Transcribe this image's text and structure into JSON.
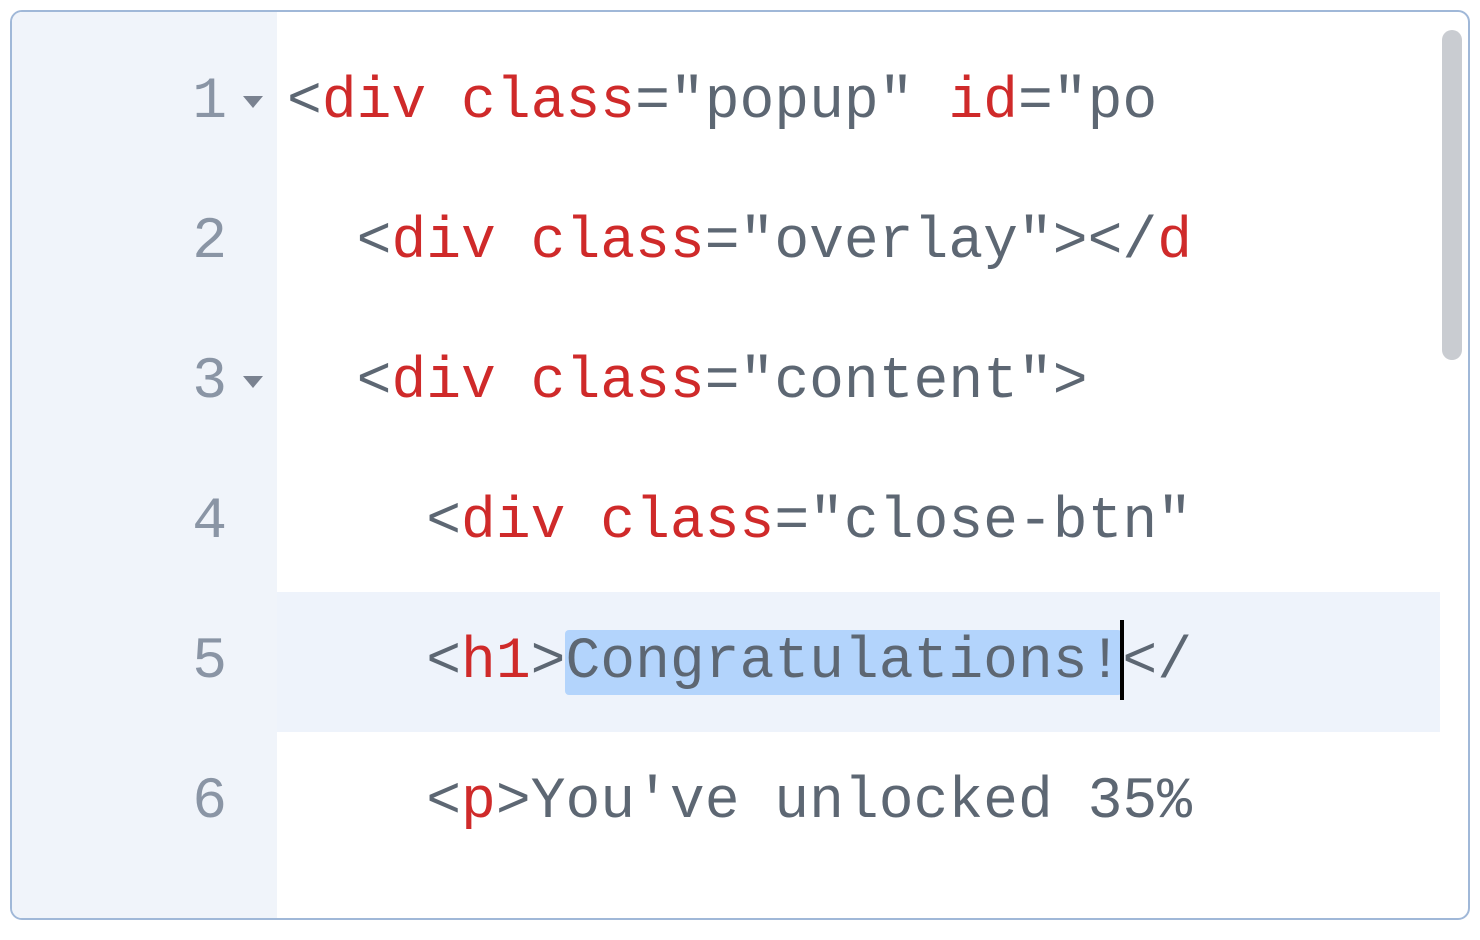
{
  "editor": {
    "lines": [
      {
        "number": "1",
        "foldable": true,
        "indent": "",
        "tokens": [
          {
            "t": "bracket",
            "v": "<"
          },
          {
            "t": "tag",
            "v": "div"
          },
          {
            "t": "text",
            "v": " "
          },
          {
            "t": "attr",
            "v": "class"
          },
          {
            "t": "punct",
            "v": "="
          },
          {
            "t": "string",
            "v": "\"popup\""
          },
          {
            "t": "text",
            "v": " "
          },
          {
            "t": "attr",
            "v": "id"
          },
          {
            "t": "punct",
            "v": "="
          },
          {
            "t": "string",
            "v": "\"po"
          }
        ]
      },
      {
        "number": "2",
        "foldable": false,
        "indent": "  ",
        "tokens": [
          {
            "t": "bracket",
            "v": "<"
          },
          {
            "t": "tag",
            "v": "div"
          },
          {
            "t": "text",
            "v": " "
          },
          {
            "t": "attr",
            "v": "class"
          },
          {
            "t": "punct",
            "v": "="
          },
          {
            "t": "string",
            "v": "\"overlay\""
          },
          {
            "t": "bracket",
            "v": ">"
          },
          {
            "t": "bracket",
            "v": "</"
          },
          {
            "t": "tag",
            "v": "d"
          }
        ]
      },
      {
        "number": "3",
        "foldable": true,
        "indent": "  ",
        "tokens": [
          {
            "t": "bracket",
            "v": "<"
          },
          {
            "t": "tag",
            "v": "div"
          },
          {
            "t": "text",
            "v": " "
          },
          {
            "t": "attr",
            "v": "class"
          },
          {
            "t": "punct",
            "v": "="
          },
          {
            "t": "string",
            "v": "\"content\""
          },
          {
            "t": "bracket",
            "v": ">"
          }
        ]
      },
      {
        "number": "4",
        "foldable": false,
        "indent": "    ",
        "tokens": [
          {
            "t": "bracket",
            "v": "<"
          },
          {
            "t": "tag",
            "v": "div"
          },
          {
            "t": "text",
            "v": " "
          },
          {
            "t": "attr",
            "v": "class"
          },
          {
            "t": "punct",
            "v": "="
          },
          {
            "t": "string",
            "v": "\"close-btn\""
          }
        ]
      },
      {
        "number": "5",
        "foldable": false,
        "active": true,
        "indent": "    ",
        "tokens": [
          {
            "t": "bracket",
            "v": "<"
          },
          {
            "t": "tag",
            "v": "h1"
          },
          {
            "t": "bracket",
            "v": ">"
          },
          {
            "t": "text",
            "v": "Congratulations!",
            "selected": true
          },
          {
            "t": "cursor"
          },
          {
            "t": "bracket",
            "v": "<"
          },
          {
            "t": "punct",
            "v": "/"
          }
        ]
      },
      {
        "number": "6",
        "foldable": false,
        "indent": "    ",
        "tokens": [
          {
            "t": "bracket",
            "v": "<"
          },
          {
            "t": "tag",
            "v": "p"
          },
          {
            "t": "bracket",
            "v": ">"
          },
          {
            "t": "text",
            "v": "You've unlocked 35%"
          }
        ]
      }
    ]
  }
}
